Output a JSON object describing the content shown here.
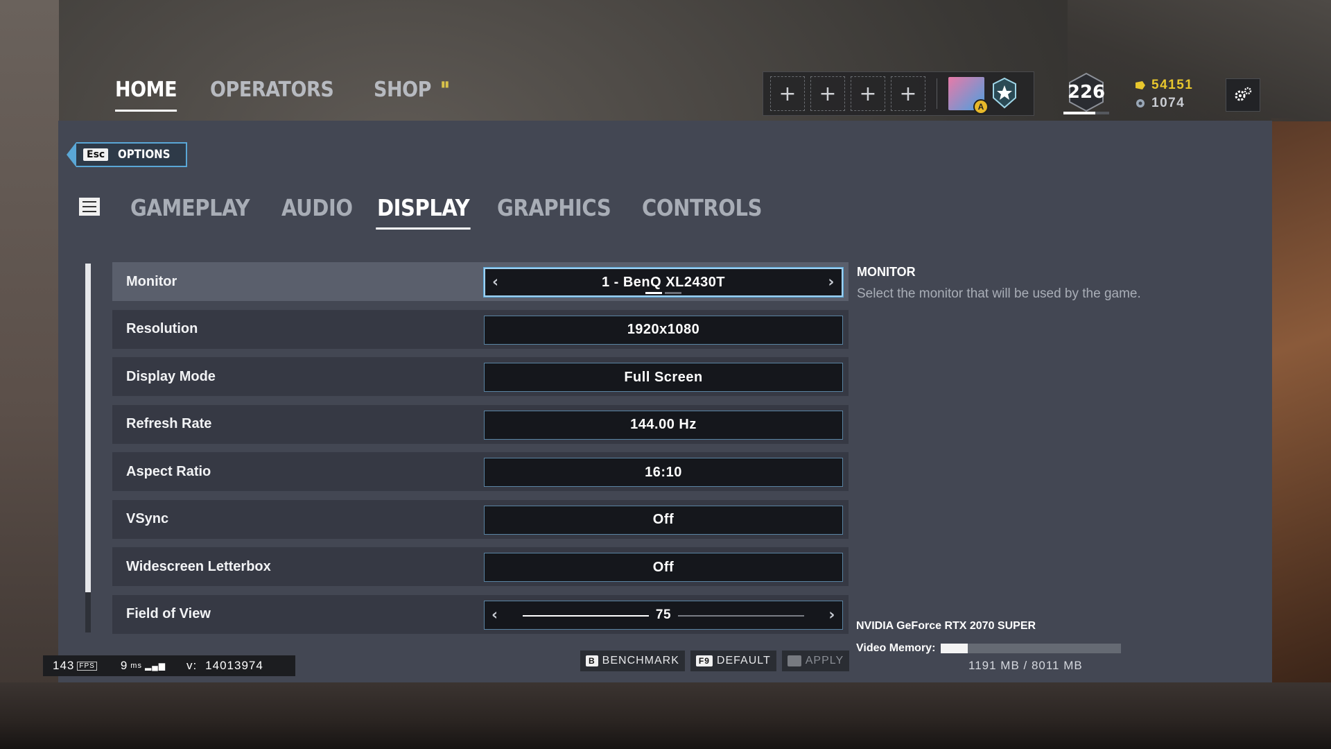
{
  "top_nav": {
    "items": [
      {
        "label": "HOME",
        "active": true
      },
      {
        "label": "OPERATORS",
        "active": false
      },
      {
        "label": "SHOP",
        "active": false
      }
    ]
  },
  "squad": {
    "empty_slot_label": "+",
    "avatar_badge": "A"
  },
  "player": {
    "level": "226",
    "level_progress": 0.7,
    "credits": "54151",
    "renown": "1074"
  },
  "options": {
    "back_key": "Esc",
    "back_label": "OPTIONS",
    "tabs": [
      {
        "label": "GAMEPLAY",
        "active": false
      },
      {
        "label": "AUDIO",
        "active": false
      },
      {
        "label": "DISPLAY",
        "active": true
      },
      {
        "label": "GRAPHICS",
        "active": false
      },
      {
        "label": "CONTROLS",
        "active": false
      }
    ],
    "settings": [
      {
        "label": "Monitor",
        "value": "1 - BenQ XL2430T",
        "type": "selector"
      },
      {
        "label": "Resolution",
        "value": "1920x1080",
        "type": "dropdown"
      },
      {
        "label": "Display Mode",
        "value": "Full Screen",
        "type": "dropdown"
      },
      {
        "label": "Refresh Rate",
        "value": "144.00 Hz",
        "type": "dropdown"
      },
      {
        "label": "Aspect Ratio",
        "value": "16:10",
        "type": "dropdown"
      },
      {
        "label": "VSync",
        "value": "Off",
        "type": "dropdown"
      },
      {
        "label": "Widescreen Letterbox",
        "value": "Off",
        "type": "dropdown"
      },
      {
        "label": "Field of View",
        "value": "75",
        "type": "slider",
        "slider_fraction": 0.45
      }
    ],
    "description": {
      "title": "MONITOR",
      "text": "Select the monitor that will be used by the game."
    }
  },
  "gpu": {
    "name": "NVIDIA GeForce RTX 2070 SUPER",
    "vram_label": "Video Memory:",
    "vram_used_fraction": 0.149,
    "vram_text": "1191 MB / 8011 MB"
  },
  "footer": {
    "benchmark_key": "B",
    "benchmark_label": "BENCHMARK",
    "default_key": "F9",
    "default_label": "DEFAULT",
    "apply_label": "APPLY"
  },
  "stats": {
    "fps": "143",
    "fps_unit": "FPS",
    "ping": "9",
    "ping_unit": "ms",
    "version_label": "v:",
    "version": "14013974"
  },
  "colors": {
    "accent": "#5aa7d6",
    "panel": "#434753",
    "credits": "#e8c72d"
  }
}
